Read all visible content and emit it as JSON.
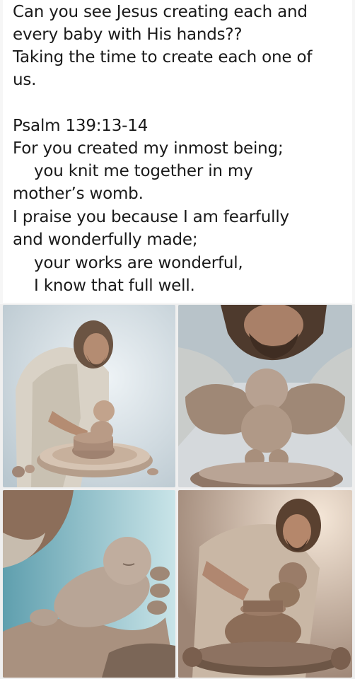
{
  "post": {
    "intro_lines": [
      "Can you see Jesus creating each and",
      "every baby with His hands??",
      "Taking the time to create each one of",
      "us."
    ],
    "verse_ref": "Psalm 139:13-14",
    "verse_lines": [
      "For you created my inmost being;",
      "you knit me together in my",
      "mother’s womb.",
      "I praise you because I am fearfully",
      "and wonderfully made;",
      "your works are wonderful,",
      "I know that full well."
    ]
  },
  "images": [
    {
      "name": "image-potter-at-wheel-full"
    },
    {
      "name": "image-hands-shaping-baby-closeup"
    },
    {
      "name": "image-sleeping-baby-in-hands"
    },
    {
      "name": "image-potter-smiling-baby-on-wheel"
    }
  ],
  "colors": {
    "text": "#1a1a1a",
    "background": "#ffffff",
    "clay": "#a08676"
  }
}
